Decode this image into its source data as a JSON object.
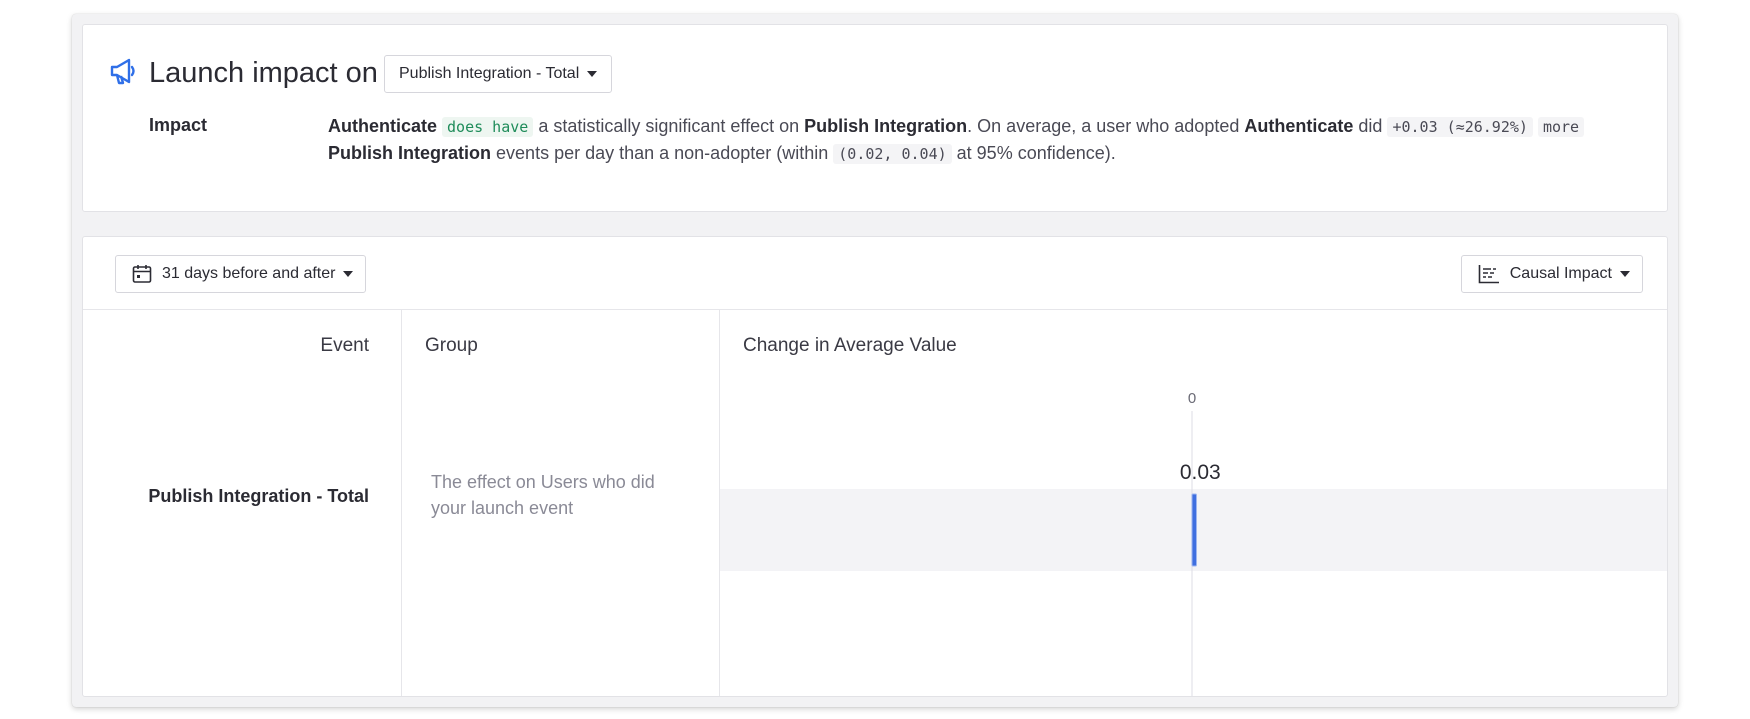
{
  "header": {
    "title": "Launch impact on",
    "metric_dropdown": "Publish Integration - Total"
  },
  "impact": {
    "label": "Impact",
    "launch_event": "Authenticate",
    "verdict": "does have",
    "text_1": "a statistically significant effect on",
    "metric": "Publish Integration",
    "text_2": ". On average, a user who adopted",
    "launch_event_2": "Authenticate",
    "text_3": "did",
    "effect": "+0.03 (≈26.92%)",
    "direction": "more",
    "metric_2": "Publish Integration",
    "text_4": "events per day than a non-adopter (within",
    "interval": "(0.02, 0.04)",
    "text_5": "at 95% confidence)."
  },
  "toolbar": {
    "range_label": "31 days before and after",
    "visualization_label": "Causal Impact"
  },
  "table": {
    "headers": {
      "event": "Event",
      "group": "Group",
      "change": "Change in Average Value"
    },
    "rows": [
      {
        "event": "Publish Integration - Total",
        "group": "The effect on Users who did your launch event"
      }
    ]
  },
  "chart_data": {
    "type": "bar",
    "categories": [
      "Publish Integration - Total"
    ],
    "values": [
      0.03
    ],
    "zero_label": "0",
    "data_labels": [
      "0.03"
    ],
    "xlabel": "Change in Average Value",
    "bar_color": "#3f6fe0"
  },
  "colors": {
    "accent": "#2f6fe8",
    "significant": "#1f8c5a"
  }
}
